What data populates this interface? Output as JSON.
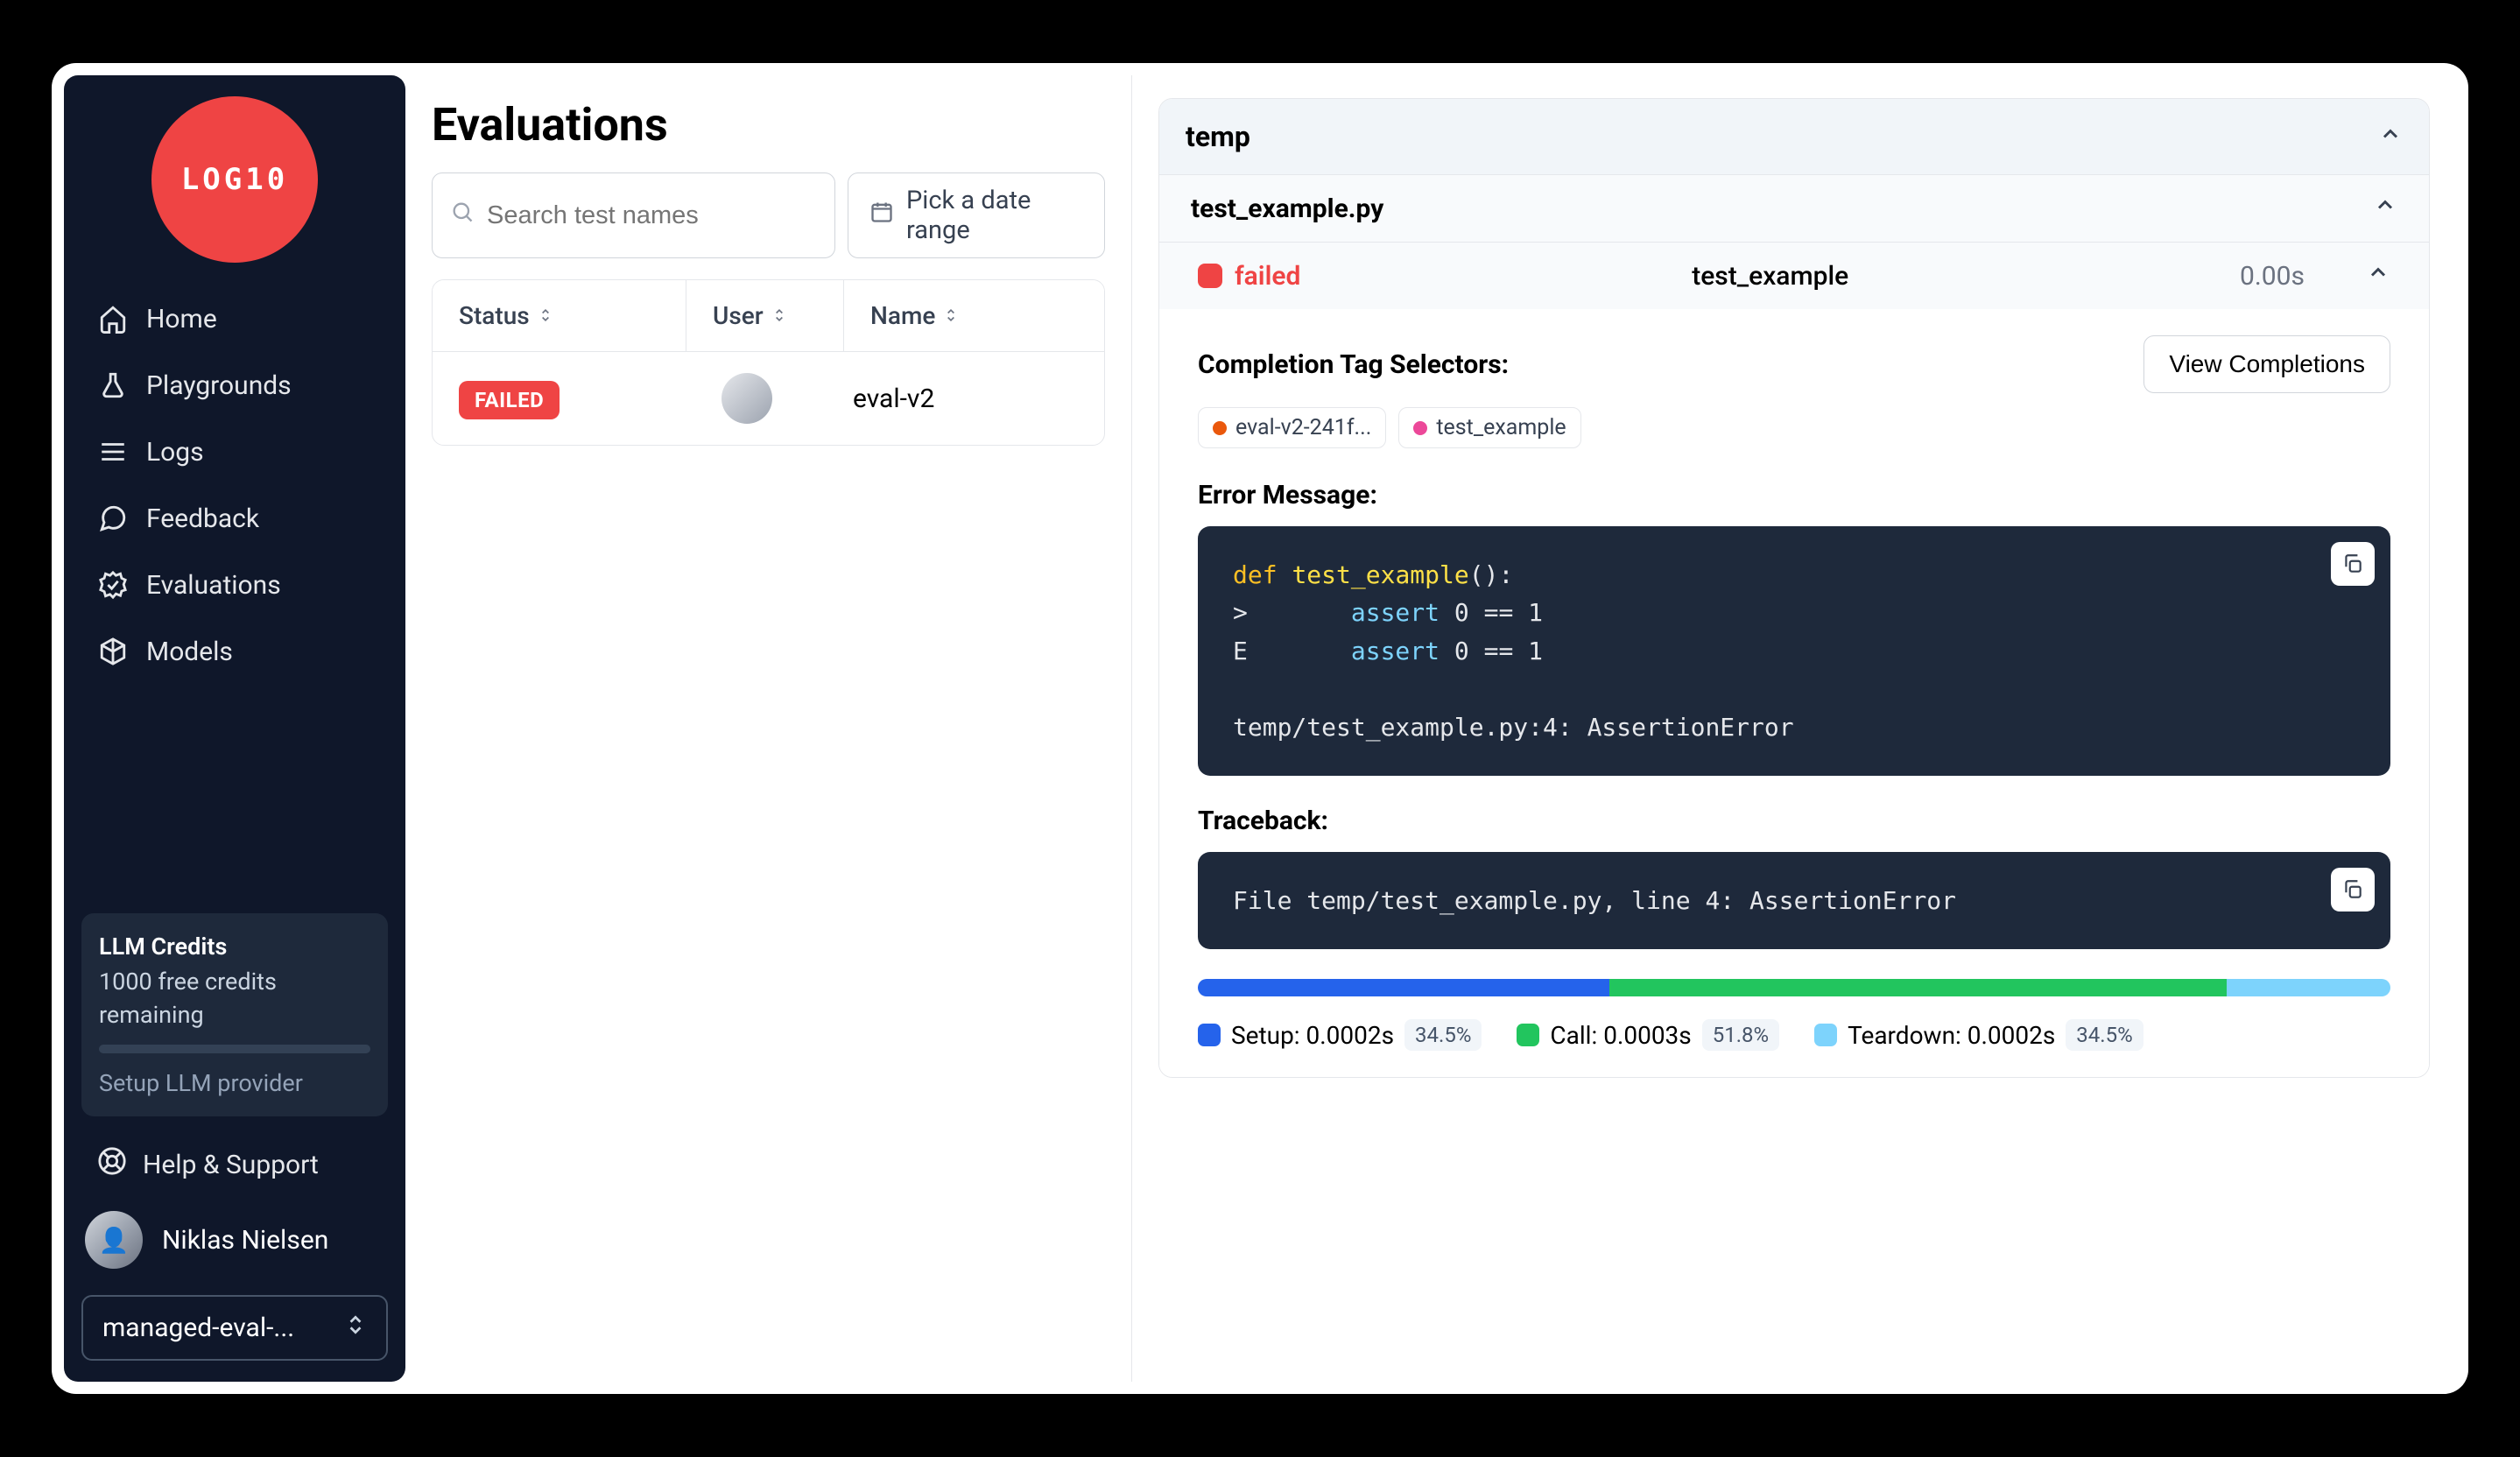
{
  "brand": {
    "logo_text": "LOG10"
  },
  "nav": {
    "items": [
      {
        "label": "Home"
      },
      {
        "label": "Playgrounds"
      },
      {
        "label": "Logs"
      },
      {
        "label": "Feedback"
      },
      {
        "label": "Evaluations"
      },
      {
        "label": "Models"
      }
    ]
  },
  "credits": {
    "title": "LLM Credits",
    "subtitle": "1000 free credits remaining",
    "setup": "Setup LLM provider"
  },
  "help": {
    "label": "Help & Support"
  },
  "user": {
    "name": "Niklas Nielsen"
  },
  "org": {
    "label": "managed-eval-..."
  },
  "page": {
    "title": "Evaluations",
    "search_placeholder": "Search test names",
    "date_label": "Pick a date range"
  },
  "table": {
    "headers": {
      "status": "Status",
      "user": "User",
      "name": "Name"
    },
    "rows": [
      {
        "status": "FAILED",
        "name": "eval-v2"
      }
    ]
  },
  "detail": {
    "suite": "temp",
    "file": "test_example.py",
    "test": {
      "status": "failed",
      "name": "test_example",
      "duration": "0.00s"
    },
    "completion_title": "Completion Tag Selectors:",
    "view_completions": "View Completions",
    "tags": [
      {
        "color": "orange",
        "text": "eval-v2-241f..."
      },
      {
        "color": "pink",
        "text": "test_example"
      }
    ],
    "error_label": "Error Message:",
    "error_code": {
      "l1_def": "def",
      "l1_fn": "test_example",
      "l1_rest": "():",
      "l2_pre": ">       ",
      "l2_as": "assert",
      "l2_rest": " 0 == 1",
      "l3_pre": "E       ",
      "l3_as": "assert",
      "l3_rest": " 0 == 1",
      "l5": "temp/test_example.py:4: AssertionError"
    },
    "traceback_label": "Traceback:",
    "traceback_code": "File temp/test_example.py, line 4: AssertionError",
    "timeline": [
      {
        "color": "blue",
        "pct": 34.5,
        "label": "Setup: 0.0002s",
        "pct_text": "34.5%"
      },
      {
        "color": "green",
        "pct": 51.8,
        "label": "Call: 0.0003s",
        "pct_text": "51.8%"
      },
      {
        "color": "light",
        "pct": 13.7,
        "label": "Teardown: 0.0002s",
        "pct_text": "34.5%"
      }
    ]
  }
}
